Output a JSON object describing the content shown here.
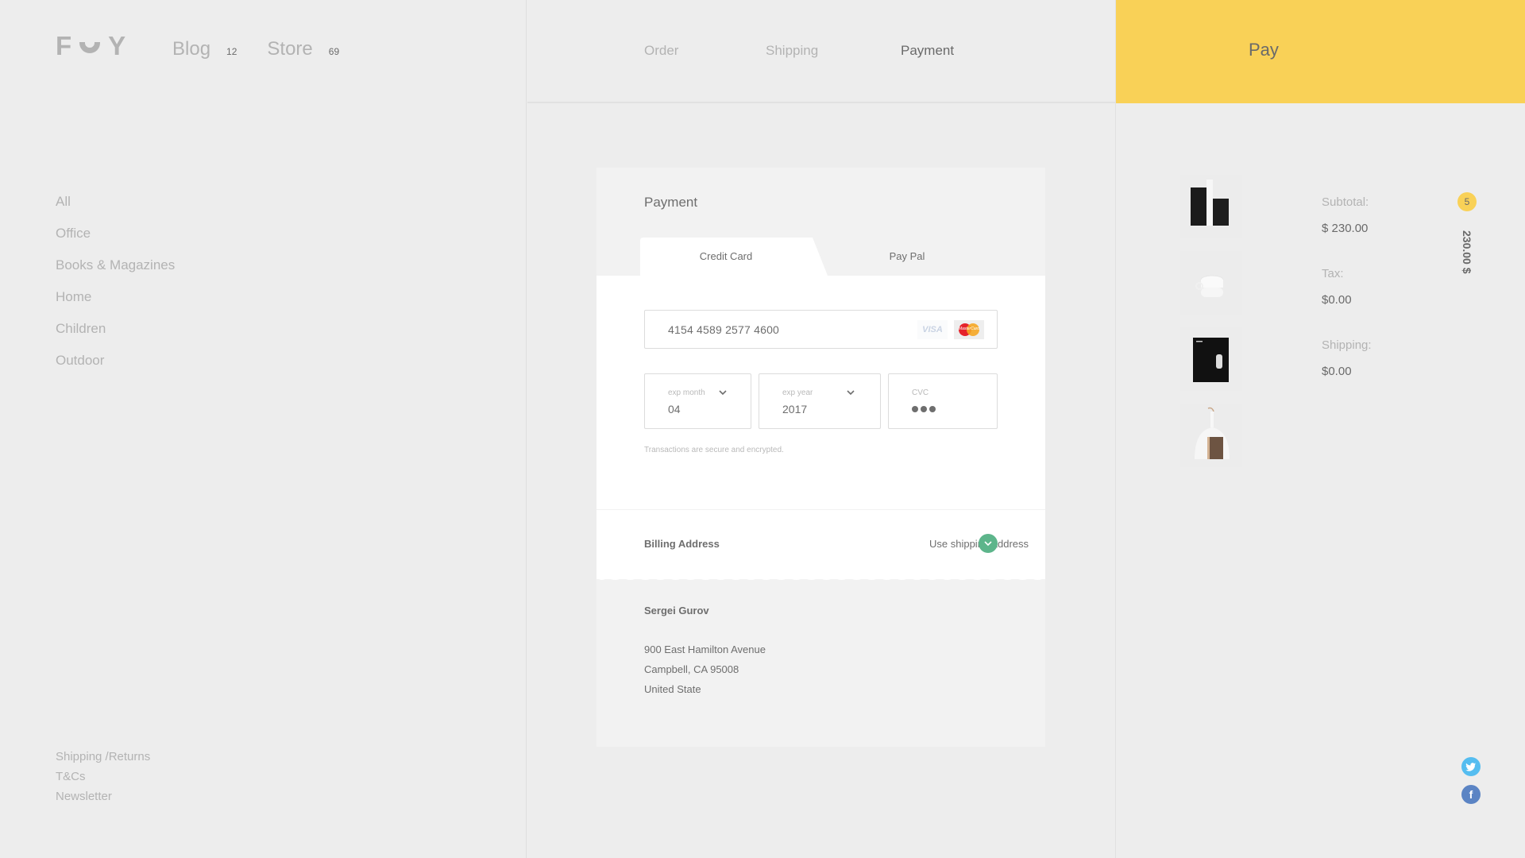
{
  "brand": {
    "logo_left": "F",
    "logo_right": "Y"
  },
  "topnav": [
    {
      "label": "Blog",
      "count": "12"
    },
    {
      "label": "Store",
      "count": "69"
    }
  ],
  "categories": [
    "All",
    "Office",
    "Books & Magazines",
    "Home",
    "Children",
    "Outdoor"
  ],
  "footer_links": [
    "Shipping /Returns",
    "T&Cs",
    "Newsletter"
  ],
  "steps": [
    {
      "label": "Order",
      "active": false
    },
    {
      "label": "Shipping",
      "active": false
    },
    {
      "label": "Payment",
      "active": true
    }
  ],
  "pay_button": "Pay",
  "payment": {
    "title": "Payment",
    "tabs": [
      {
        "label": "Credit Card",
        "active": true
      },
      {
        "label": "Pay Pal",
        "active": false
      }
    ],
    "card_number": "4154 4589 2577 4600",
    "card_brands": {
      "visa": "VISA",
      "mastercard": "MasterCard"
    },
    "exp_month": {
      "label": "exp month",
      "value": "04"
    },
    "exp_year": {
      "label": "exp year",
      "value": "2017"
    },
    "cvc": {
      "label": "CVC",
      "value": "•••"
    },
    "secure_note": "Transactions are secure and encrypted."
  },
  "billing": {
    "label": "Billing Address",
    "option": "Use shipping address",
    "name": "Sergei Gurov",
    "address_lines": [
      "900 East Hamilton Avenue",
      "Campbell, CA 95008",
      "United State"
    ]
  },
  "cart": {
    "items": [
      "bookends",
      "cups",
      "book",
      "brush"
    ],
    "count": "5",
    "total_vertical": "230.00 $",
    "summary": [
      {
        "label": "Subtotal:",
        "value": "$ 230.00"
      },
      {
        "label": "Tax:",
        "value": "$0.00"
      },
      {
        "label": "Shipping:",
        "value": "$0.00"
      }
    ]
  },
  "social": [
    "twitter-icon",
    "facebook-icon"
  ],
  "colors": {
    "accent": "#f9d157",
    "success": "#5db58b",
    "twitter": "#55bdf0",
    "facebook": "#5b84c4"
  }
}
